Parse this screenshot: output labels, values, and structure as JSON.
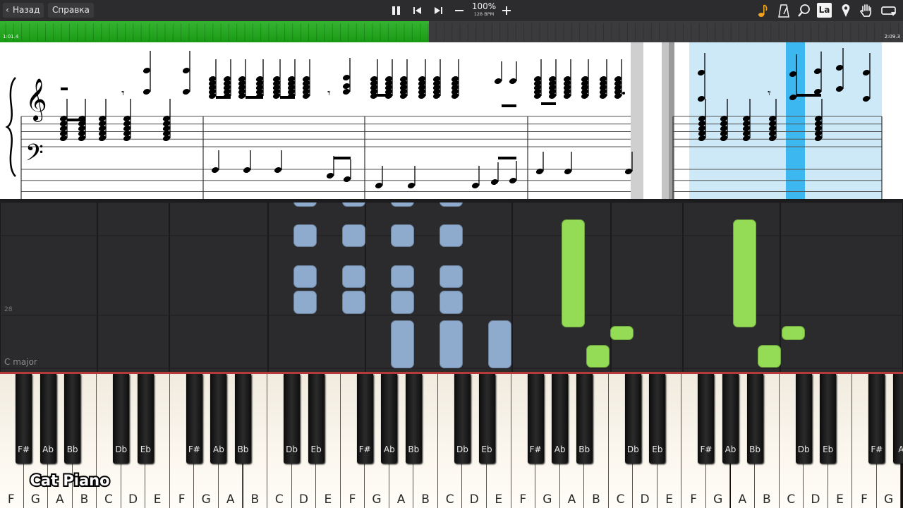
{
  "toolbar": {
    "back_label": "Назад",
    "help_label": "Справка",
    "tempo_percent": "100%",
    "tempo_bpm": "128 BPM",
    "buttons": [
      "pause-icon",
      "skip-back-icon",
      "skip-forward-icon",
      "minus-icon",
      "plus-icon"
    ],
    "right_icons": [
      "note-icon",
      "metronome-icon",
      "magnifier-icon",
      "la-icon",
      "location-pin-icon",
      "hand-icon",
      "loop-icon"
    ],
    "la_label": "La"
  },
  "progress": {
    "current_time": "1:01.4",
    "total_time": "2:09.3",
    "fraction": 0.475
  },
  "piano_roll": {
    "key_label": "C major",
    "row_number": "28"
  },
  "keyboard": {
    "white_keys": [
      "F",
      "G",
      "A",
      "B",
      "C",
      "D",
      "E",
      "F",
      "G",
      "A",
      "B",
      "C",
      "D",
      "E",
      "F",
      "G",
      "A",
      "B",
      "C",
      "D",
      "E",
      "F",
      "G",
      "A",
      "B",
      "C",
      "D",
      "E",
      "F",
      "G",
      "A",
      "B",
      "C",
      "D",
      "E",
      "F",
      "G"
    ],
    "black_keys": [
      "F#",
      "Ab",
      "Bb",
      "Db",
      "Eb",
      "F#",
      "Ab",
      "Bb",
      "Db",
      "Eb",
      "F#",
      "Ab",
      "Bb",
      "Db",
      "Eb",
      "F#",
      "Ab",
      "Bb",
      "Db",
      "Eb",
      "F#",
      "Ab",
      "Bb",
      "Db",
      "Eb",
      "F#",
      "A"
    ]
  },
  "watermark": "Cat Piano",
  "colors": {
    "progress_green": "#1f9f1a",
    "left_hand_notes": "#8eabcd",
    "right_hand_notes": "#94dc55",
    "highlight_section": "#cde9f7",
    "current_position": "#3db7f0",
    "keyboard_top_line": "#b53a3a"
  }
}
